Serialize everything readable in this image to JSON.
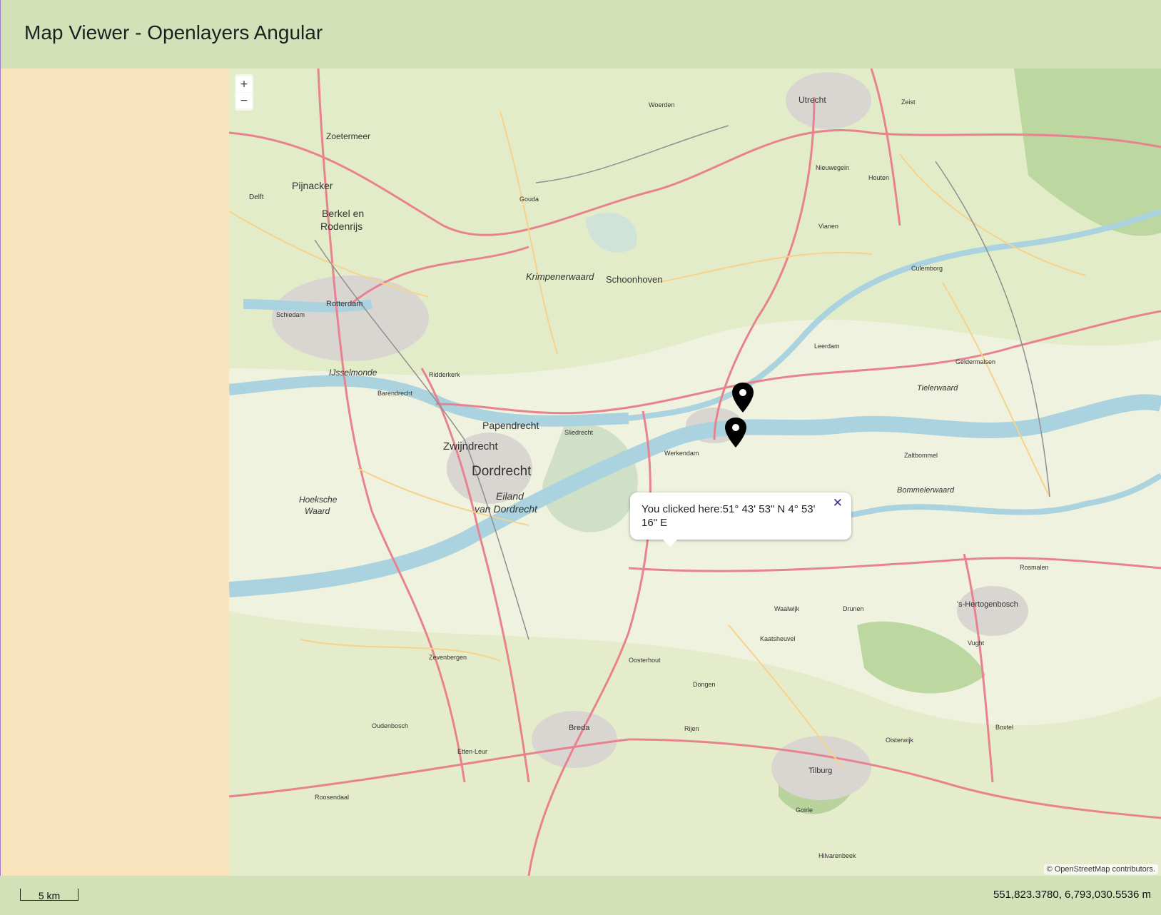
{
  "app": {
    "title": "Map Viewer - Openlayers Angular"
  },
  "map": {
    "zoom_in_label": "+",
    "zoom_out_label": "−",
    "popup": {
      "text": "You clicked here:51° 43' 53\" N 4° 53' 16\" E",
      "closer": "✕"
    },
    "attribution": "© OpenStreetMap contributors.",
    "marker_icon": "map-pin-icon",
    "places": {
      "utrecht": "Utrecht",
      "zoetermeer": "Zoetermeer",
      "pijnacker": "Pijnacker",
      "berkel": "Berkel en",
      "rodenrijs": "Rodenrijs",
      "delft": "Delft",
      "rotterdam": "Rotterdam",
      "schiedam": "Schiedam",
      "gouda": "Gouda",
      "dordrecht": "Dordrecht",
      "zwijndrecht": "Zwijndrecht",
      "papendrecht": "Papendrecht",
      "sliedrecht": "Sliedrecht",
      "breda": "Breda",
      "tilburg": "Tilburg",
      "den_bosch": "'s-Hertogenbosch",
      "waalwijk": "Waalwijk",
      "oosterhout": "Oosterhout",
      "dongen": "Dongen",
      "culemborg": "Culemborg",
      "geldermalsen": "Geldermalsen",
      "leerdam": "Leerdam",
      "zaltbommel": "Zaltbommel",
      "bommelerwaard": "Bommelerwaard",
      "tielerwaard": "Tielerwaard",
      "vianen": "Vianen",
      "nieuwegein": "Nieuwegein",
      "woerden": "Woerden",
      "zeist": "Zeist",
      "houten": "Houten",
      "ijsselmonde": "IJsselmonde",
      "eiland": "Eiland",
      "van_dordrecht": "van Dordrecht",
      "hoeksche": "Hoeksche",
      "waard": "Waard",
      "krimpenerwaard": "Krimpenerwaard",
      "schoonhoven": "Schoonhoven",
      "zevenbergen": "Zevenbergen",
      "roosendaal": "Roosendaal",
      "oudenbosch": "Oudenbosch",
      "etten_leur": "Etten-Leur",
      "drunen": "Drunen",
      "vught": "Vught",
      "rosmalen": "Rosmalen",
      "kaatsheuvel": "Kaatsheuvel",
      "rijen": "Rijen",
      "goirle": "Goirle",
      "boxtel": "Boxtel",
      "werkendam": "Werkendam",
      "hilvarenbeek": "Hilvarenbeek",
      "oisterwijk": "Oisterwijk",
      "ridderkerk": "Ridderkerk",
      "barendrecht": "Barendrecht"
    }
  },
  "footer": {
    "scale_label": "5 km",
    "coordinates": "551,823.3780, 6,793,030.5536 m"
  }
}
